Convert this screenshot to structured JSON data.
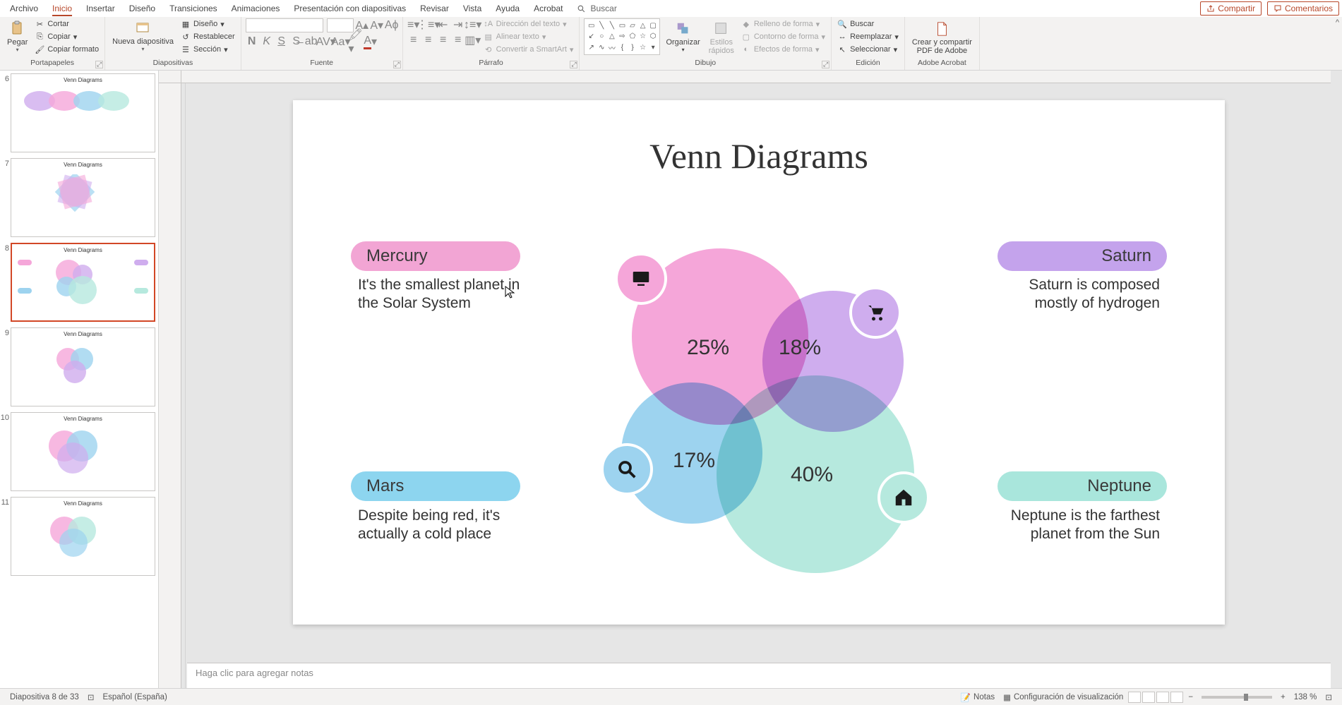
{
  "menubar": {
    "tabs": [
      "Archivo",
      "Inicio",
      "Insertar",
      "Diseño",
      "Transiciones",
      "Animaciones",
      "Presentación con diapositivas",
      "Revisar",
      "Vista",
      "Ayuda",
      "Acrobat"
    ],
    "active_index": 1,
    "search_placeholder": "Buscar",
    "share": "Compartir",
    "comments": "Comentarios"
  },
  "ribbon": {
    "clipboard": {
      "title": "Portapapeles",
      "paste": "Pegar",
      "cut": "Cortar",
      "copy": "Copiar",
      "format_painter": "Copiar formato"
    },
    "slides": {
      "title": "Diapositivas",
      "new_slide": "Nueva diapositiva",
      "layout": "Diseño",
      "reset": "Restablecer",
      "section": "Sección"
    },
    "font": {
      "title": "Fuente"
    },
    "paragraph": {
      "title": "Párrafo",
      "text_direction": "Dirección del texto",
      "align_text": "Alinear texto",
      "convert_smartart": "Convertir a SmartArt"
    },
    "drawing": {
      "title": "Dibujo",
      "arrange": "Organizar",
      "quick_styles_l1": "Estilos",
      "quick_styles_l2": "rápidos",
      "shape_fill": "Relleno de forma",
      "shape_outline": "Contorno de forma",
      "shape_effects": "Efectos de forma"
    },
    "editing": {
      "title": "Edición",
      "find": "Buscar",
      "replace": "Reemplazar",
      "select": "Seleccionar"
    },
    "acrobat": {
      "title": "Adobe Acrobat",
      "create_l1": "Crear y compartir",
      "create_l2": "PDF de Adobe"
    }
  },
  "thumbs": {
    "start": 6,
    "common_title": "Venn Diagrams",
    "items": [
      {
        "num": "6"
      },
      {
        "num": "7"
      },
      {
        "num": "8",
        "active": true
      },
      {
        "num": "9"
      },
      {
        "num": "10"
      },
      {
        "num": "11"
      }
    ]
  },
  "slide": {
    "title": "Venn Diagrams",
    "labels": {
      "mercury": {
        "name": "Mercury",
        "desc": "It's the smallest planet in the Solar System"
      },
      "saturn": {
        "name": "Saturn",
        "desc": "Saturn is composed mostly of hydrogen"
      },
      "mars": {
        "name": "Mars",
        "desc": "Despite being red, it's actually a cold place"
      },
      "neptune": {
        "name": "Neptune",
        "desc": "Neptune is the farthest planet from the Sun"
      }
    },
    "percentages": {
      "p25": "25%",
      "p18": "18%",
      "p17": "17%",
      "p40": "40%"
    }
  },
  "chart_data": {
    "type": "venn",
    "title": "Venn Diagrams",
    "sets": [
      {
        "name": "Mercury",
        "value": 25,
        "color": "#f5a6d9",
        "desc": "It's the smallest planet in the Solar System"
      },
      {
        "name": "Saturn",
        "value": 18,
        "color": "#cfadee",
        "desc": "Saturn is composed mostly of hydrogen"
      },
      {
        "name": "Mars",
        "value": 17,
        "color": "#9dd3ef",
        "desc": "Despite being red, it's actually a cold place"
      },
      {
        "name": "Neptune",
        "value": 40,
        "color": "#b6e9de",
        "desc": "Neptune is the farthest planet from the Sun"
      }
    ]
  },
  "notes_placeholder": "Haga clic para agregar notas",
  "statusbar": {
    "slide_info": "Diapositiva 8 de 33",
    "language": "Español (España)",
    "notes": "Notas",
    "display_config": "Configuración de visualización",
    "zoom": "138 %"
  }
}
